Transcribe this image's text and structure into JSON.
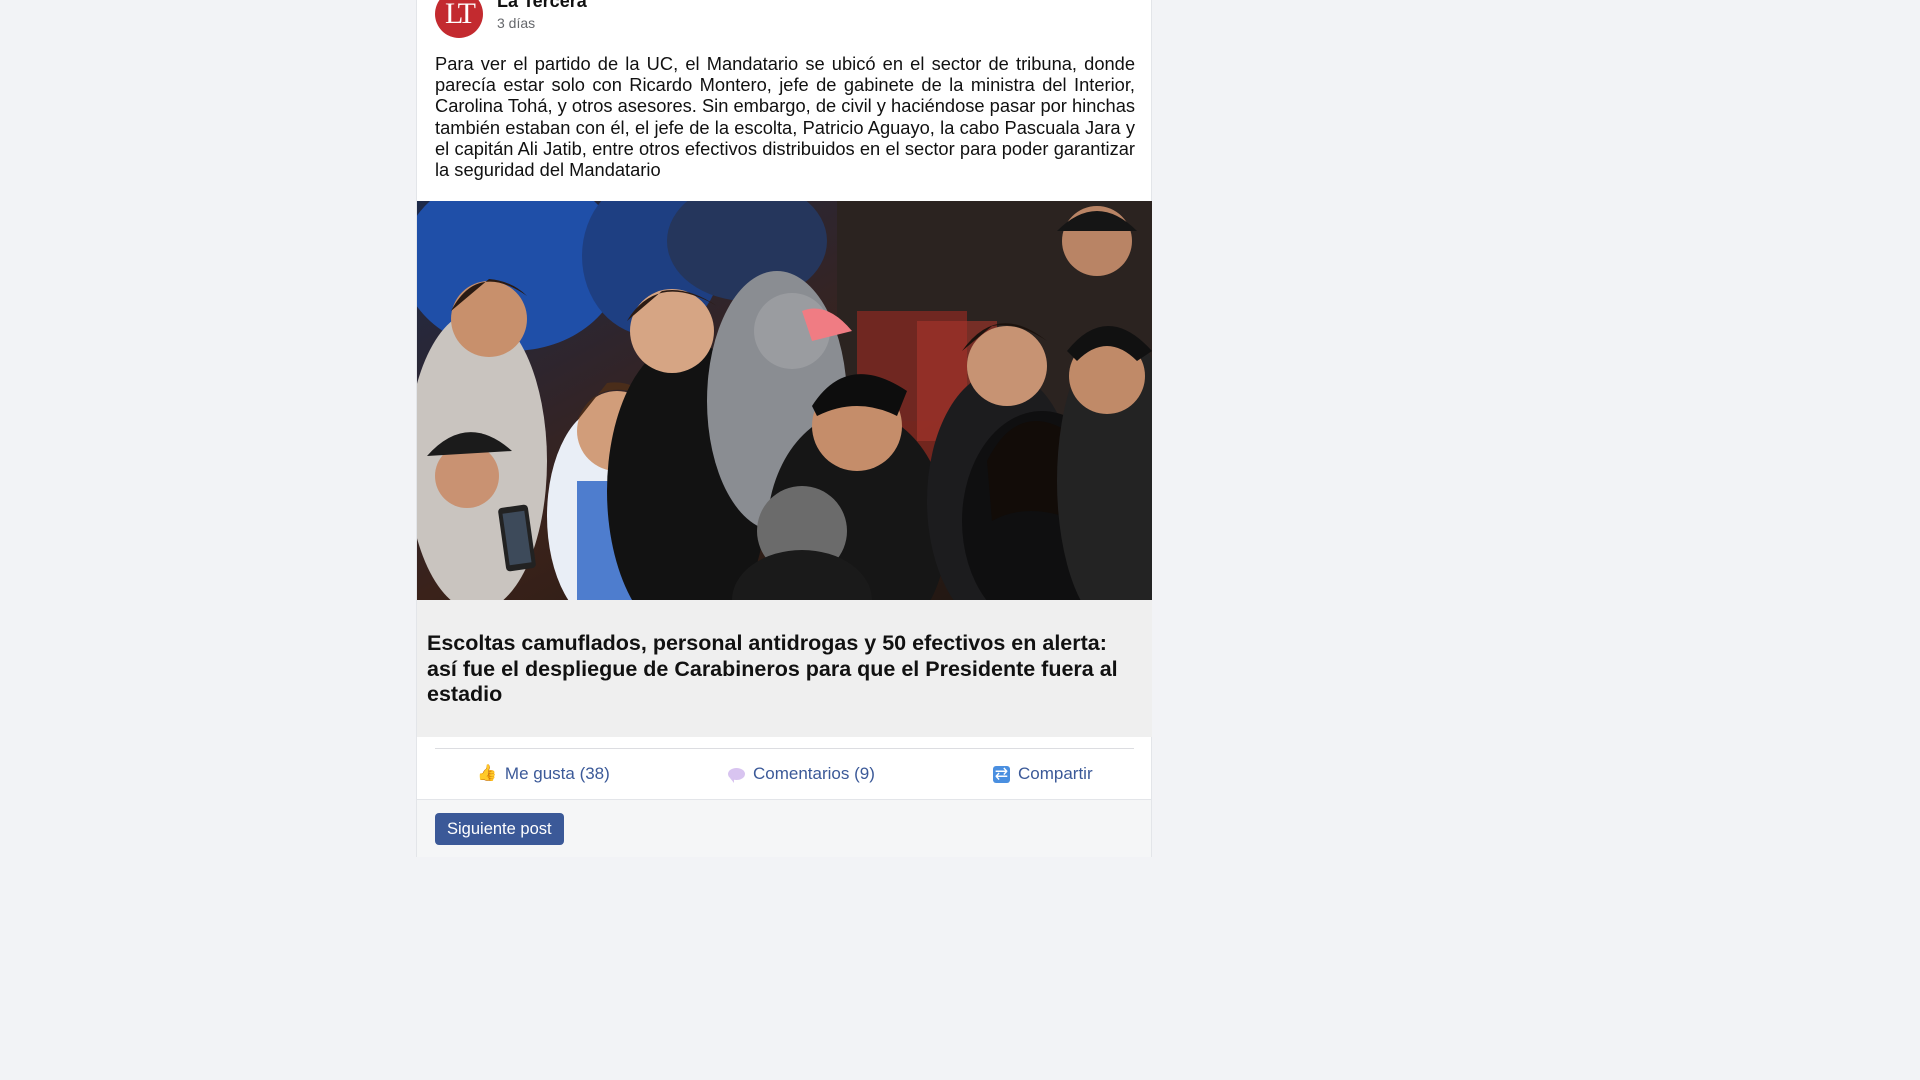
{
  "post": {
    "page_name": "La Tercera",
    "avatar_initials": "LT",
    "time": "3 días",
    "body": "Para ver el partido de la UC, el Mandatario se ubicó en el sector de tribuna, donde parecía estar solo con Ricardo Montero, jefe de gabinete de la ministra del Interior, Carolina Tohá, y otros asesores. Sin embargo, de civil y haciéndose pasar por hinchas también estaban con él, el jefe de la escolta, Patricio Aguayo, la cabo Pascuala Jara y el capitán Ali Jatib, entre otros efectivos distribuidos en el sector para poder garantizar la seguridad del Mandatario",
    "link_title": "Escoltas camuflados, personal antidrogas y 50 efectivos en alerta: así fue el despliegue de Carabineros para que el Presidente fuera al estadio"
  },
  "actions": {
    "like_label": "Me gusta (38)",
    "comment_label": "Comentarios (9)",
    "share_label": "Compartir",
    "like_icon": "thumbs-up-icon",
    "comment_icon": "speech-bubble-icon",
    "share_icon": "share-arrows-icon"
  },
  "footer": {
    "next_label": "Siguiente post"
  },
  "colors": {
    "brand_red": "#c32a2f",
    "link_blue": "#3b5998",
    "page_bg": "#f2f3f6"
  }
}
